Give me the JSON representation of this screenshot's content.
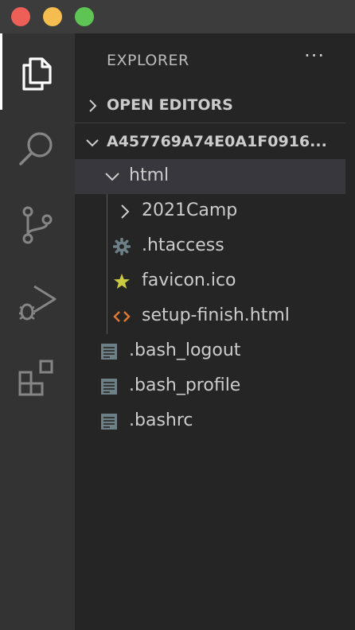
{
  "window": {
    "controls": [
      "close",
      "minimize",
      "zoom"
    ]
  },
  "activity_bar": [
    {
      "icon": "files-icon",
      "active": true
    },
    {
      "icon": "search-icon",
      "active": false
    },
    {
      "icon": "source-control-icon",
      "active": false
    },
    {
      "icon": "run-debug-icon",
      "active": false
    },
    {
      "icon": "extensions-icon",
      "active": false
    }
  ],
  "sidebar": {
    "title": "EXPLORER",
    "more": "···",
    "open_editors": "OPEN EDITORS",
    "workspace": "A457769A74E0A1F0916...",
    "tree": {
      "html": "html",
      "camp": "2021Camp",
      "htaccess": ".htaccess",
      "favicon": "favicon.ico",
      "setup": "setup-finish.html",
      "bash_logout": ".bash_logout",
      "bash_profile": ".bash_profile",
      "bashrc": ".bashrc"
    }
  },
  "colors": {
    "titlebar": "#3c3c3c",
    "activity_bar": "#333333",
    "sidebar": "#252526",
    "selection": "#37373d",
    "star_icon": "#cbcb41",
    "html_icon": "#e37933",
    "gear_icon": "#6d8086",
    "file_icon": "#6d8086"
  }
}
